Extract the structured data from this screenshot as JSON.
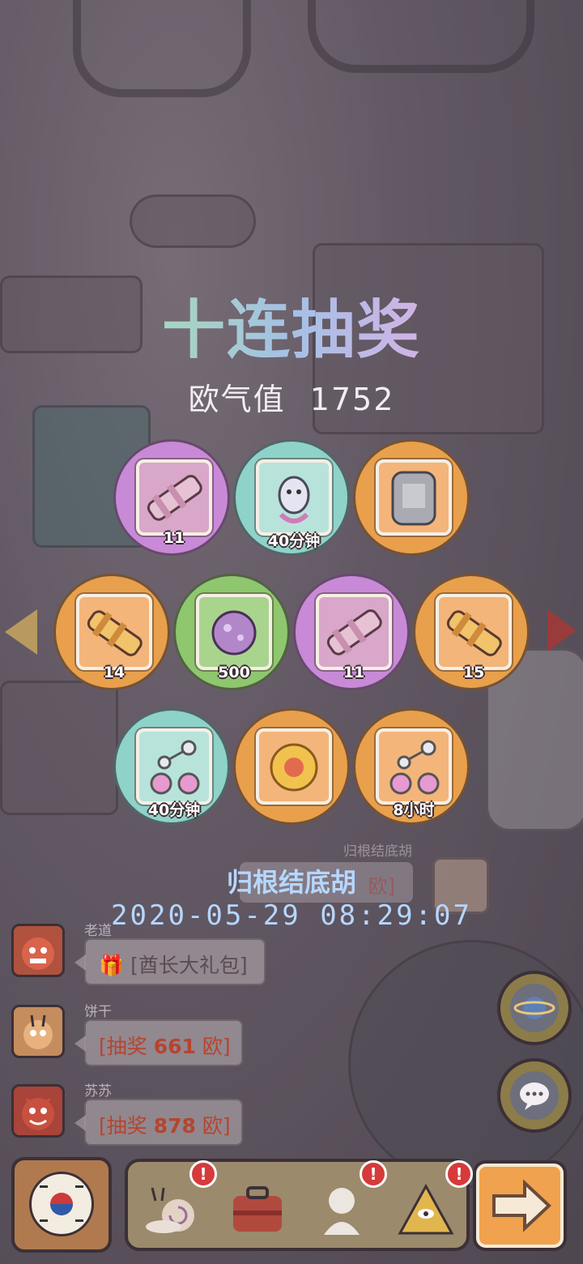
{
  "title": "十连抽奖",
  "luck": {
    "label": "欧气值",
    "value": "1752"
  },
  "rewards": [
    {
      "row": 1,
      "color": "purple",
      "item": "telescope-icon",
      "qty": "11"
    },
    {
      "row": 1,
      "color": "teal",
      "item": "snail-icon",
      "qty": "40分钟"
    },
    {
      "row": 1,
      "color": "orange",
      "item": "stone-tablet-icon",
      "qty": ""
    },
    {
      "row": 2,
      "color": "orange",
      "item": "telescope-gold-icon",
      "qty": "14"
    },
    {
      "row": 2,
      "color": "green",
      "item": "microbe-icon",
      "qty": "500"
    },
    {
      "row": 2,
      "color": "purple",
      "item": "telescope-icon",
      "qty": "11"
    },
    {
      "row": 2,
      "color": "orange",
      "item": "telescope-gold-icon",
      "qty": "15"
    },
    {
      "row": 3,
      "color": "teal",
      "item": "molecule-flask-icon",
      "qty": "40分钟"
    },
    {
      "row": 3,
      "color": "orange",
      "item": "gold-coin-icon",
      "qty": ""
    },
    {
      "row": 3,
      "color": "orange",
      "item": "molecule-flask-icon",
      "qty": "8小时"
    }
  ],
  "winner": {
    "name": "归根结底胡",
    "time": "2020-05-29  08:29:07",
    "ghost_name": "归根结底胡",
    "ghost_text": "欧]"
  },
  "chat": [
    {
      "name": "老道",
      "text": "[酋长大礼包]",
      "gift": true
    },
    {
      "name": "饼干",
      "prefix": "[抽奖 ",
      "amount": "661",
      "suffix": " 欧]"
    },
    {
      "name": "苏苏",
      "prefix": "[抽奖 ",
      "amount": "878",
      "suffix": " 欧]"
    }
  ],
  "bottom_bar": {
    "badge": "!"
  },
  "colors": {
    "purple": "#c88ad6",
    "teal": "#8fd2c9",
    "orange": "#e8a04c",
    "green": "#8ec76e",
    "timestamp": "#b6d7ff",
    "luck_text": "#f3eef2",
    "red_amount": "#b5452f"
  }
}
